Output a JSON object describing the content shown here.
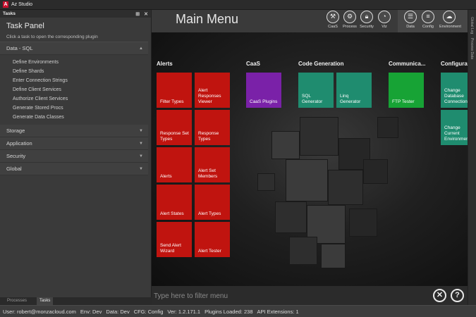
{
  "app": {
    "title": "Az Studio",
    "logo_letter": "A"
  },
  "tasks_panel": {
    "header": "Tasks",
    "pin_icon": "pin-icon",
    "close_icon": "close-icon",
    "title": "Task Panel",
    "hint": "Click a task to open the corresponding plugin",
    "groups": [
      {
        "label": "Data - SQL",
        "expanded": true,
        "items": [
          "Define Environments",
          "Define Shards",
          "Enter Connection Strings",
          "Define Client Services",
          "Authorize Client Services",
          "Generate Stored Procs",
          "Generate Data Classes"
        ]
      },
      {
        "label": "Storage",
        "expanded": false
      },
      {
        "label": "Application",
        "expanded": false
      },
      {
        "label": "Security",
        "expanded": false
      },
      {
        "label": "Global",
        "expanded": false
      }
    ],
    "tabs": [
      "Processes",
      "Tasks"
    ]
  },
  "main": {
    "title": "Main Menu",
    "toolbar": [
      {
        "label": "CaaS",
        "icon": "hammer-icon"
      },
      {
        "label": "Process",
        "icon": "gear-icon"
      },
      {
        "label": "Security",
        "icon": "lock-icon"
      },
      {
        "label": "Viz",
        "icon": "chart-icon"
      },
      {
        "label": "Data",
        "icon": "database-icon"
      },
      {
        "label": "Config",
        "icon": "config-icon"
      },
      {
        "label": "Environment",
        "icon": "cloud-icon"
      }
    ],
    "columns": [
      {
        "title": "Alerts",
        "tiles": [
          "Filter Types",
          "Alert Responses Viewer",
          "Response Set Types",
          "Response Types",
          "Alerts",
          "Alert Set Members",
          "Alert States",
          "Alert Types",
          "Send Alert Wizard",
          "Alert Tester"
        ]
      },
      {
        "title": "CaaS",
        "tiles": [
          "CaaS Plugins"
        ]
      },
      {
        "title": "Code Generation",
        "tiles": [
          "SQL Generator",
          "Linq Generator"
        ]
      },
      {
        "title": "Communica...",
        "tiles": [
          "FTP Tester"
        ]
      },
      {
        "title": "Configurat",
        "tiles": [
          "Change Database Connection",
          "Change Current Environment"
        ]
      }
    ],
    "filter_placeholder": "Type here to filter menu",
    "close_button": "✕",
    "help_button": "?"
  },
  "right_strip": [
    "Global Log",
    "Process Data"
  ],
  "status": {
    "user": "User: robert@monzacloud.com",
    "env": "Env: Dev",
    "data": "Data: Dev",
    "cfg": "CFG: Config",
    "ver": "Ver: 1.2.171.1",
    "plugins": "Plugins Loaded: 238",
    "api": "API Extensions: 1"
  },
  "colors": {
    "alerts_tile": "#c0140f",
    "caas_tile": "#7a21a8",
    "codegen_tile": "#1f8c6f",
    "comm_tile": "#17a335",
    "config_tile": "#1f8c6f"
  }
}
